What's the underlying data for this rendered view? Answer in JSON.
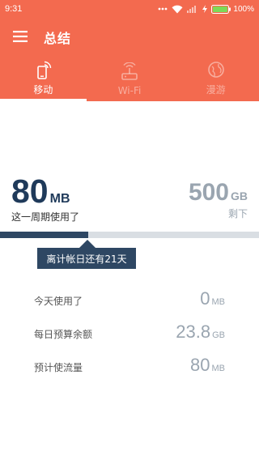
{
  "status_bar": {
    "time": "9:31",
    "battery": "100%"
  },
  "app_bar": {
    "title": "总结"
  },
  "tabs": [
    {
      "label": "移动",
      "icon": "mobile-signal-icon",
      "active": true
    },
    {
      "label": "Wi-Fi",
      "icon": "router-icon",
      "active": false
    },
    {
      "label": "漫游",
      "icon": "globe-icon",
      "active": false
    }
  ],
  "usage": {
    "used_value": "80",
    "used_unit": "MB",
    "used_label": "这一周期使用了",
    "remaining_value": "500",
    "remaining_unit": "GB",
    "remaining_label": "剩下",
    "progress_fraction": 0.34
  },
  "cycle_tip": "离计帐日还有21天",
  "stats": [
    {
      "label": "今天使用了",
      "value": "0",
      "unit": "MB"
    },
    {
      "label": "每日预算余额",
      "value": "23.8",
      "unit": "GB"
    },
    {
      "label": "预计使流量",
      "value": "80",
      "unit": "MB"
    }
  ],
  "colors": {
    "primary": "#f36a4f",
    "dark_blue": "#2e4763",
    "muted_gray": "#9aa5b0"
  }
}
